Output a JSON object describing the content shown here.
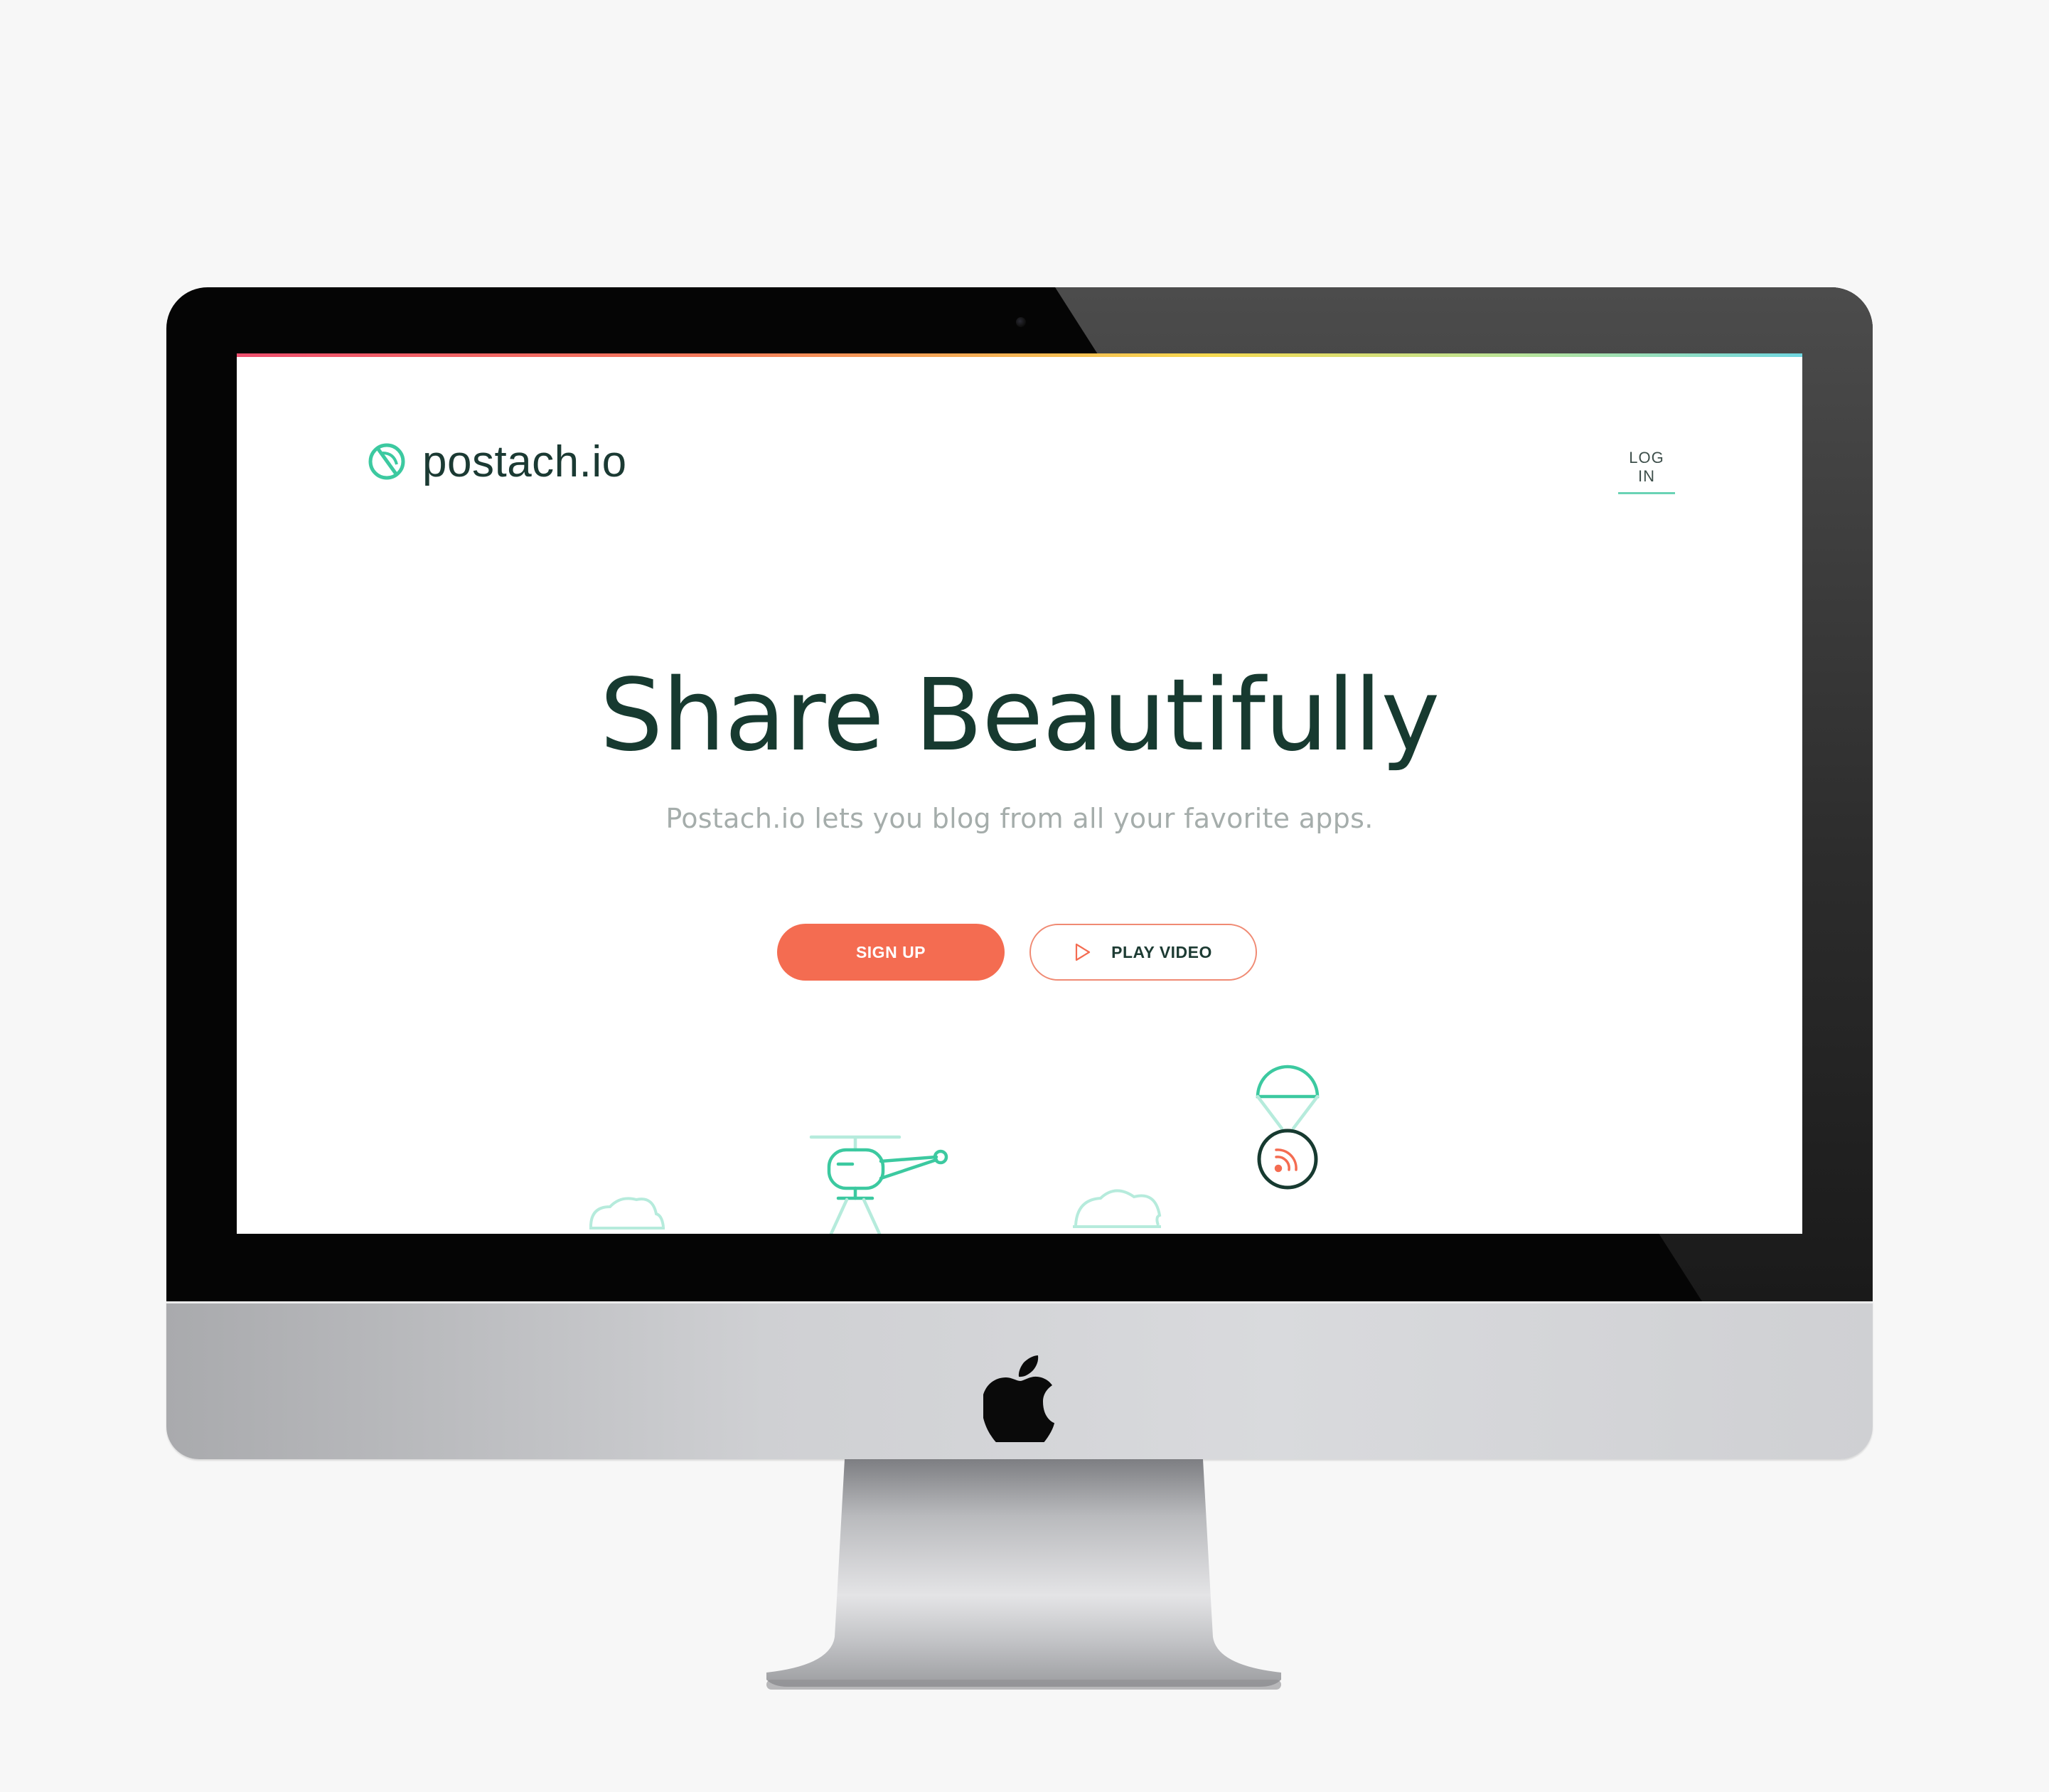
{
  "site": {
    "brand_name": "postach.io",
    "nav": {
      "login_label": "LOG IN"
    },
    "hero": {
      "title": "Share Beautifully",
      "subtitle": "Postach.io lets you blog from all your favorite apps."
    },
    "actions": {
      "signup_label": "SIGN UP",
      "video_label": "PLAY VIDEO"
    }
  },
  "colors": {
    "brand_green": "#3cc9a0",
    "accent_orange": "#f46c51",
    "text_dark": "#173a30",
    "text_muted": "#a5adab",
    "page_background": "#f7f7f7"
  },
  "icons": {
    "brand": "leaf-logo-icon",
    "play": "play-icon",
    "rss": "rss-icon",
    "device": "apple-logo-icon"
  }
}
